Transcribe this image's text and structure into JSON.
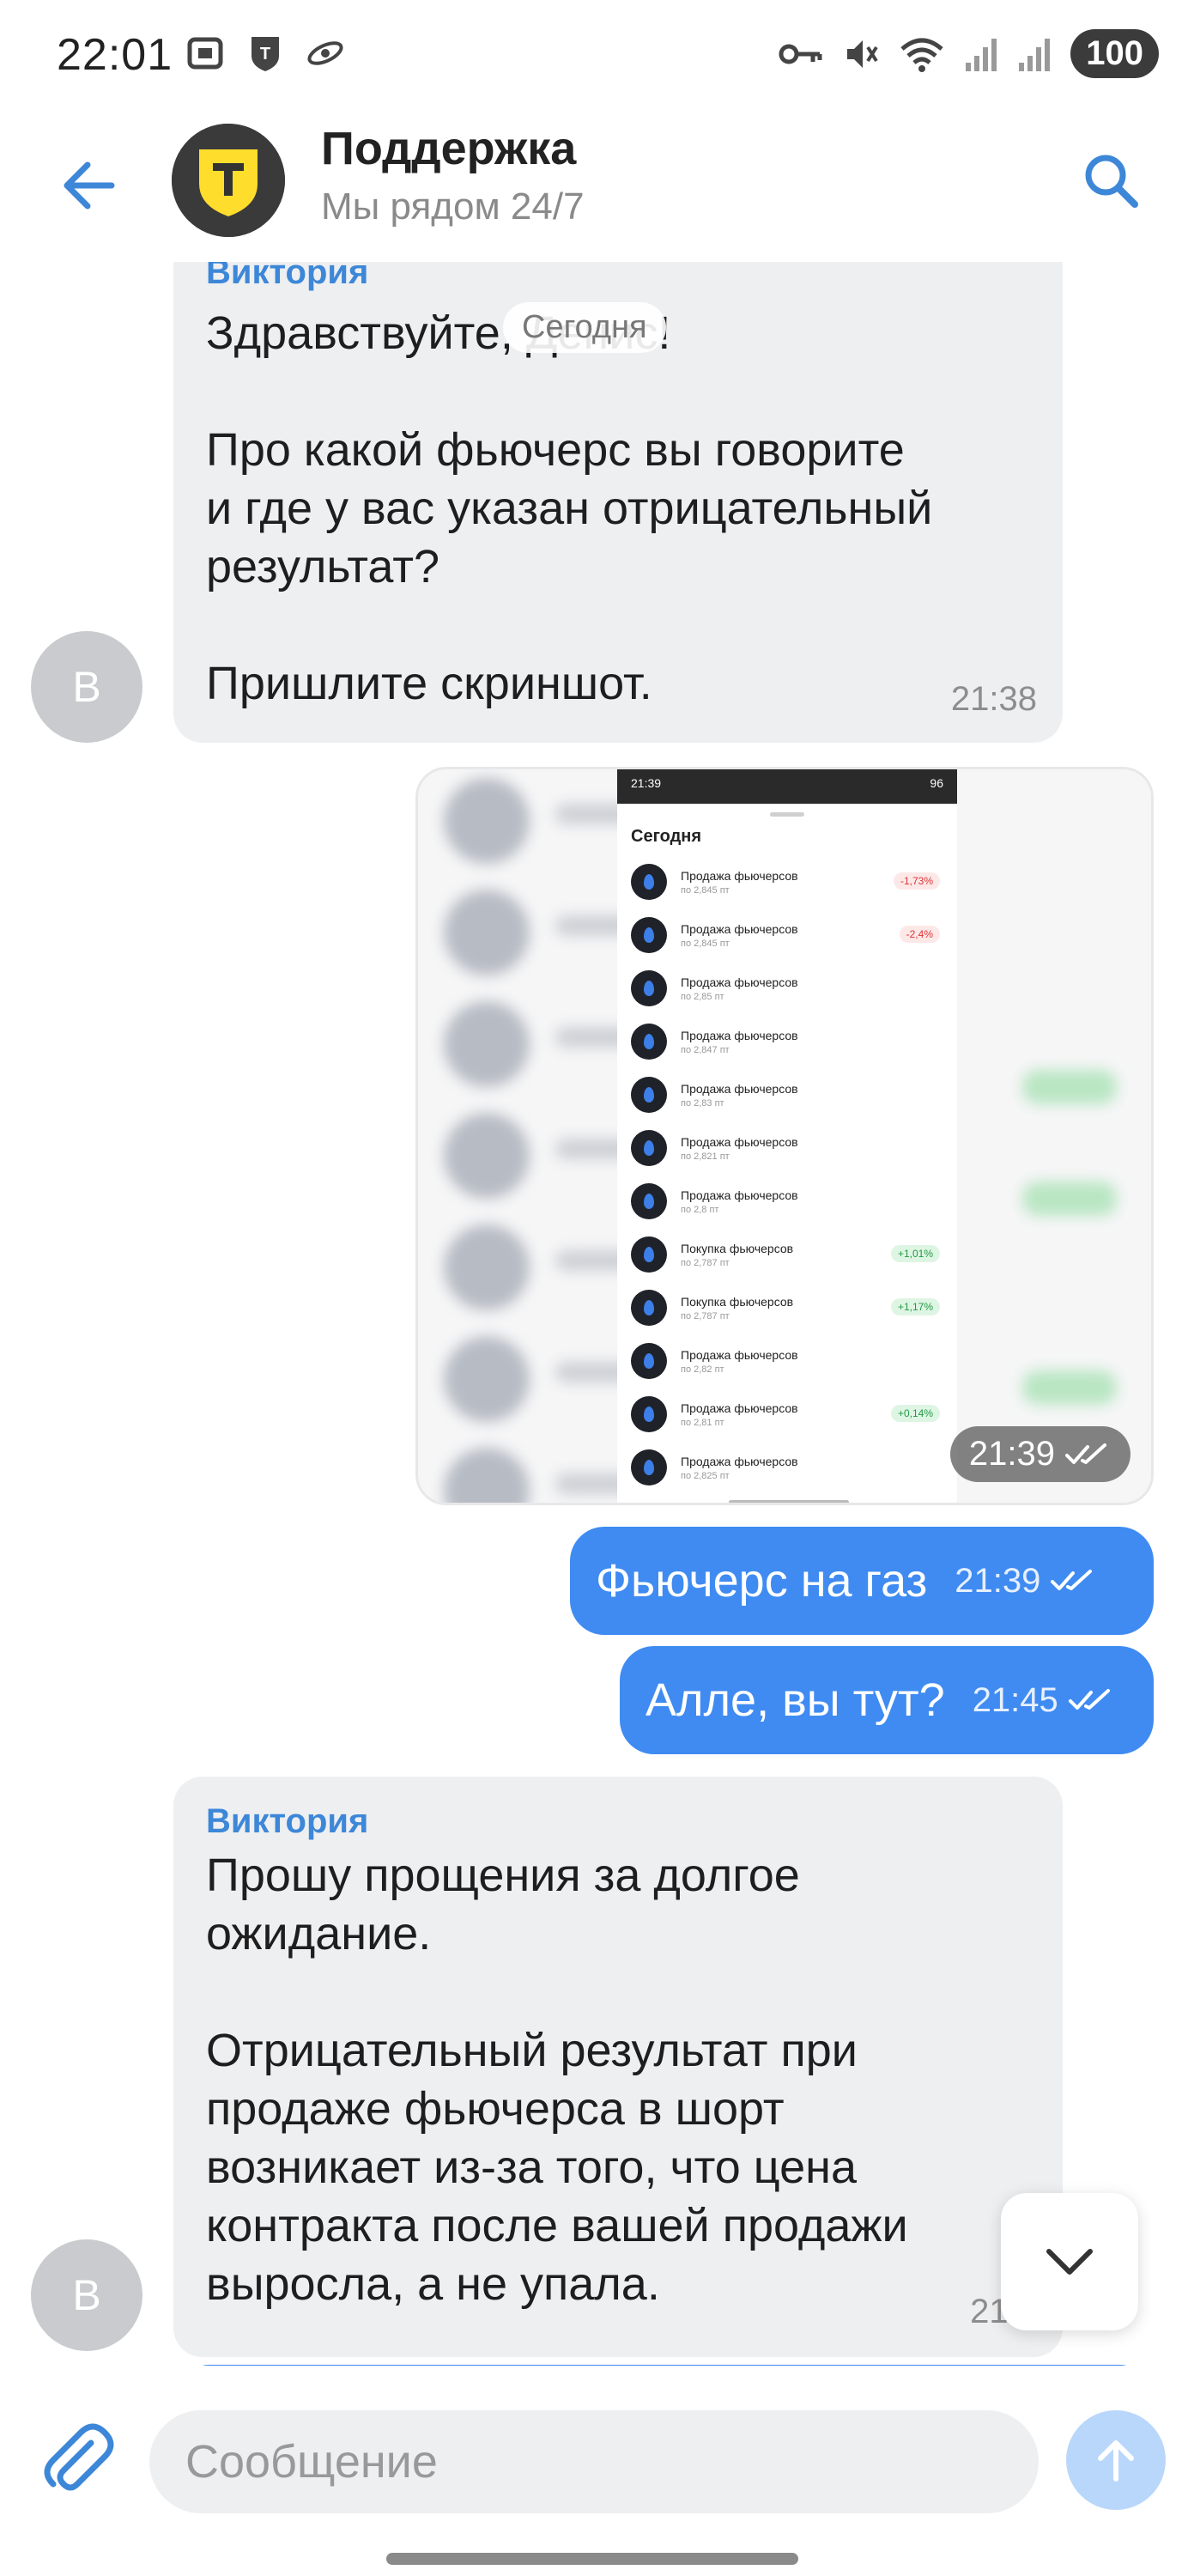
{
  "status_bar": {
    "time": "22:01",
    "battery": "100"
  },
  "header": {
    "title": "Поддержка",
    "subtitle": "Мы рядом 24/7"
  },
  "date_pill": "Сегодня",
  "messages": [
    {
      "sender": "Виктория",
      "text": "Здравствуйте, Денис!\n\nПро какой фьючерс вы говорите\nи где у вас указан отрицательный\nрезультат?\n\nПришлите скриншот.",
      "time": "21:38",
      "avatar": "В"
    },
    {
      "type": "image",
      "time": "21:39"
    },
    {
      "text": "Фьючерс на газ",
      "time": "21:39"
    },
    {
      "text": "Алле, вы тут?",
      "time": "21:45"
    },
    {
      "sender": "Виктория",
      "text": "Прошу прощения за долгое\nожидание.\n\nОтрицательный результат при\nпродаже фьючерса в шорт\nвозникает из-за того, что цена\nконтракта после вашей продажи\nвыросла, а не упала.",
      "time": "21:5",
      "avatar": "В"
    }
  ],
  "screenshot": {
    "status_time": "21:39",
    "battery": "96",
    "title": "Сегодня",
    "trades": [
      {
        "name": "Продажа фьючерсов",
        "price": "по 2,845 пт",
        "badge": "-1,73%",
        "kind": "neg"
      },
      {
        "name": "Продажа фьючерсов",
        "price": "по 2,845 пт",
        "badge": "-2,4%",
        "kind": "neg"
      },
      {
        "name": "Продажа фьючерсов",
        "price": "по 2,85 пт",
        "badge": "",
        "kind": ""
      },
      {
        "name": "Продажа фьючерсов",
        "price": "по 2,847 пт",
        "badge": "",
        "kind": ""
      },
      {
        "name": "Продажа фьючерсов",
        "price": "по 2,83 пт",
        "badge": "",
        "kind": ""
      },
      {
        "name": "Продажа фьючерсов",
        "price": "по 2,821 пт",
        "badge": "",
        "kind": ""
      },
      {
        "name": "Продажа фьючерсов",
        "price": "по 2,8 пт",
        "badge": "",
        "kind": ""
      },
      {
        "name": "Покупка фьючерсов",
        "price": "по 2,787 пт",
        "badge": "+1,01%",
        "kind": "pos"
      },
      {
        "name": "Покупка фьючерсов",
        "price": "по 2,787 пт",
        "badge": "+1,17%",
        "kind": "pos"
      },
      {
        "name": "Продажа фьючерсов",
        "price": "по 2,82 пт",
        "badge": "",
        "kind": ""
      },
      {
        "name": "Продажа фьючерсов",
        "price": "по 2,81 пт",
        "badge": "+0,14%",
        "kind": "pos"
      },
      {
        "name": "Продажа фьючерсов",
        "price": "по 2,825 пт",
        "badge": "",
        "kind": ""
      }
    ]
  },
  "composer": {
    "placeholder": "Сообщение"
  },
  "colors": {
    "accent": "#3f8bf2",
    "incoming": "#eeeff1",
    "sender": "#3d87d8"
  }
}
